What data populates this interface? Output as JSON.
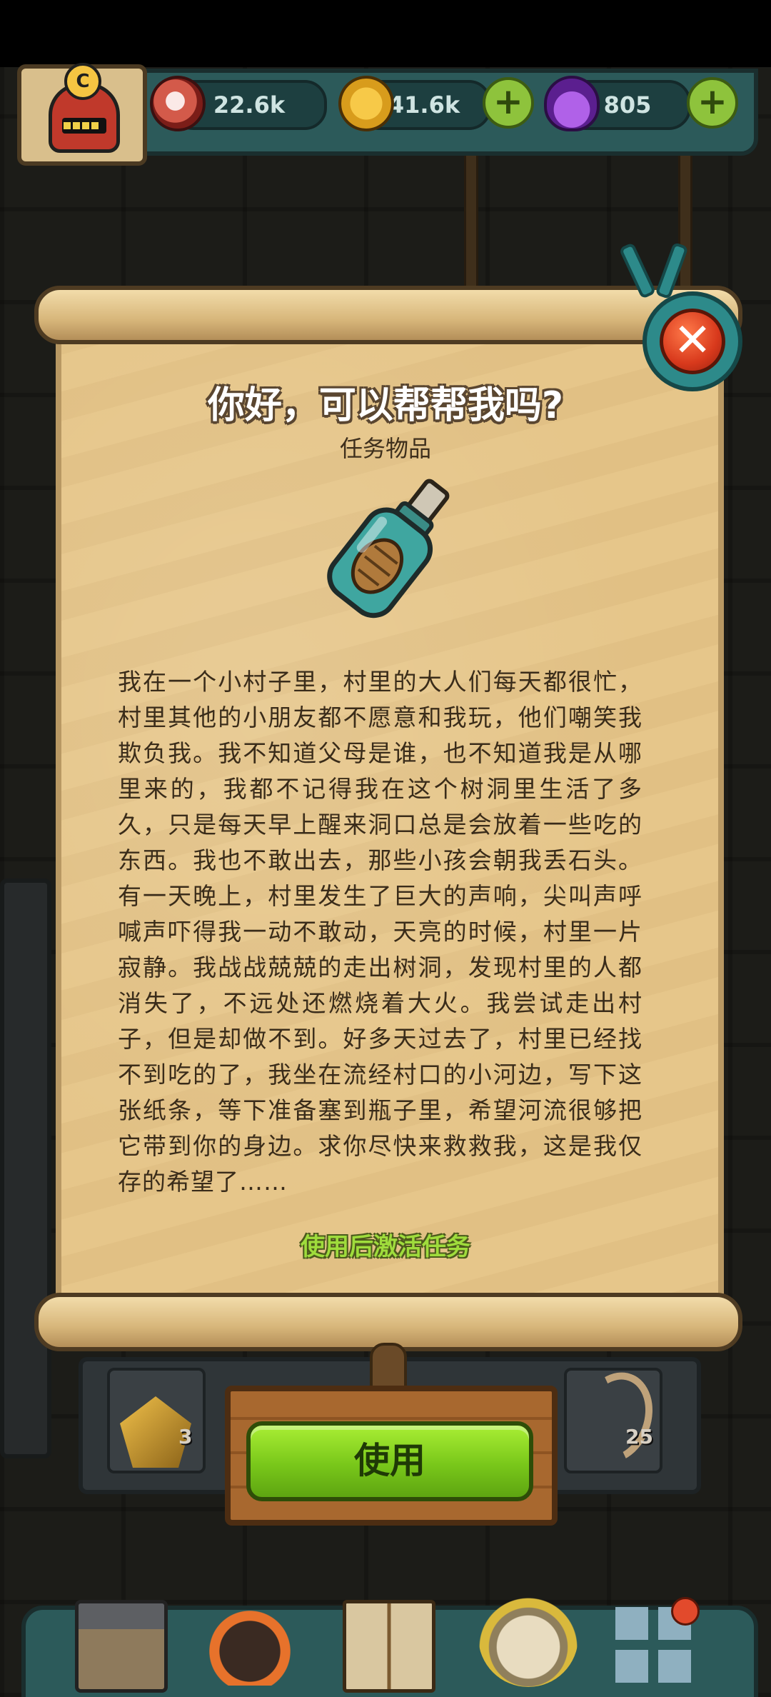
{
  "hud": {
    "eyes_value": "22.6k",
    "coins_value": "41.6k",
    "potions_value": "805",
    "avatar_badge": "C",
    "plus_symbol": "+"
  },
  "dialog": {
    "title": "你好，可以帮帮我吗?",
    "subtitle": "任务物品",
    "close_symbol": "✕",
    "story": "我在一个小村子里，村里的大人们每天都很忙，村里其他的小朋友都不愿意和我玩，他们嘲笑我欺负我。我不知道父母是谁，也不知道我是从哪里来的，我都不记得我在这个树洞里生活了多久，只是每天早上醒来洞口总是会放着一些吃的东西。我也不敢出去，那些小孩会朝我丢石头。有一天晚上，村里发生了巨大的声响，尖叫声呼喊声吓得我一动不敢动，天亮的时候，村里一片寂静。我战战兢兢的走出树洞，发现村里的人都消失了，不远处还燃烧着大火。我尝试走出村子，但是却做不到。好多天过去了，村里已经找不到吃的了，我坐在流经村口的小河边，写下这张纸条，等下准备塞到瓶子里，希望河流很够把它带到你的身边。求你尽快来救救我，这是我仅存的希望了……",
    "hint": "使用后激活任务",
    "use_button": "使用"
  },
  "inventory": {
    "slot1_count": "3",
    "slot5_count": "25"
  },
  "icons": [
    "eye-icon",
    "coin-icon",
    "potion-icon",
    "close-icon",
    "bottle-icon",
    "castle-icon",
    "monster-icon",
    "book-icon",
    "bag-icon",
    "grid-icon"
  ],
  "colors": {
    "scroll": "#e6c68a",
    "hud_teal": "#2c5a5a",
    "button_green": "#79c71a",
    "hint_green": "#9fdc3c",
    "close_red": "#d8391c"
  }
}
